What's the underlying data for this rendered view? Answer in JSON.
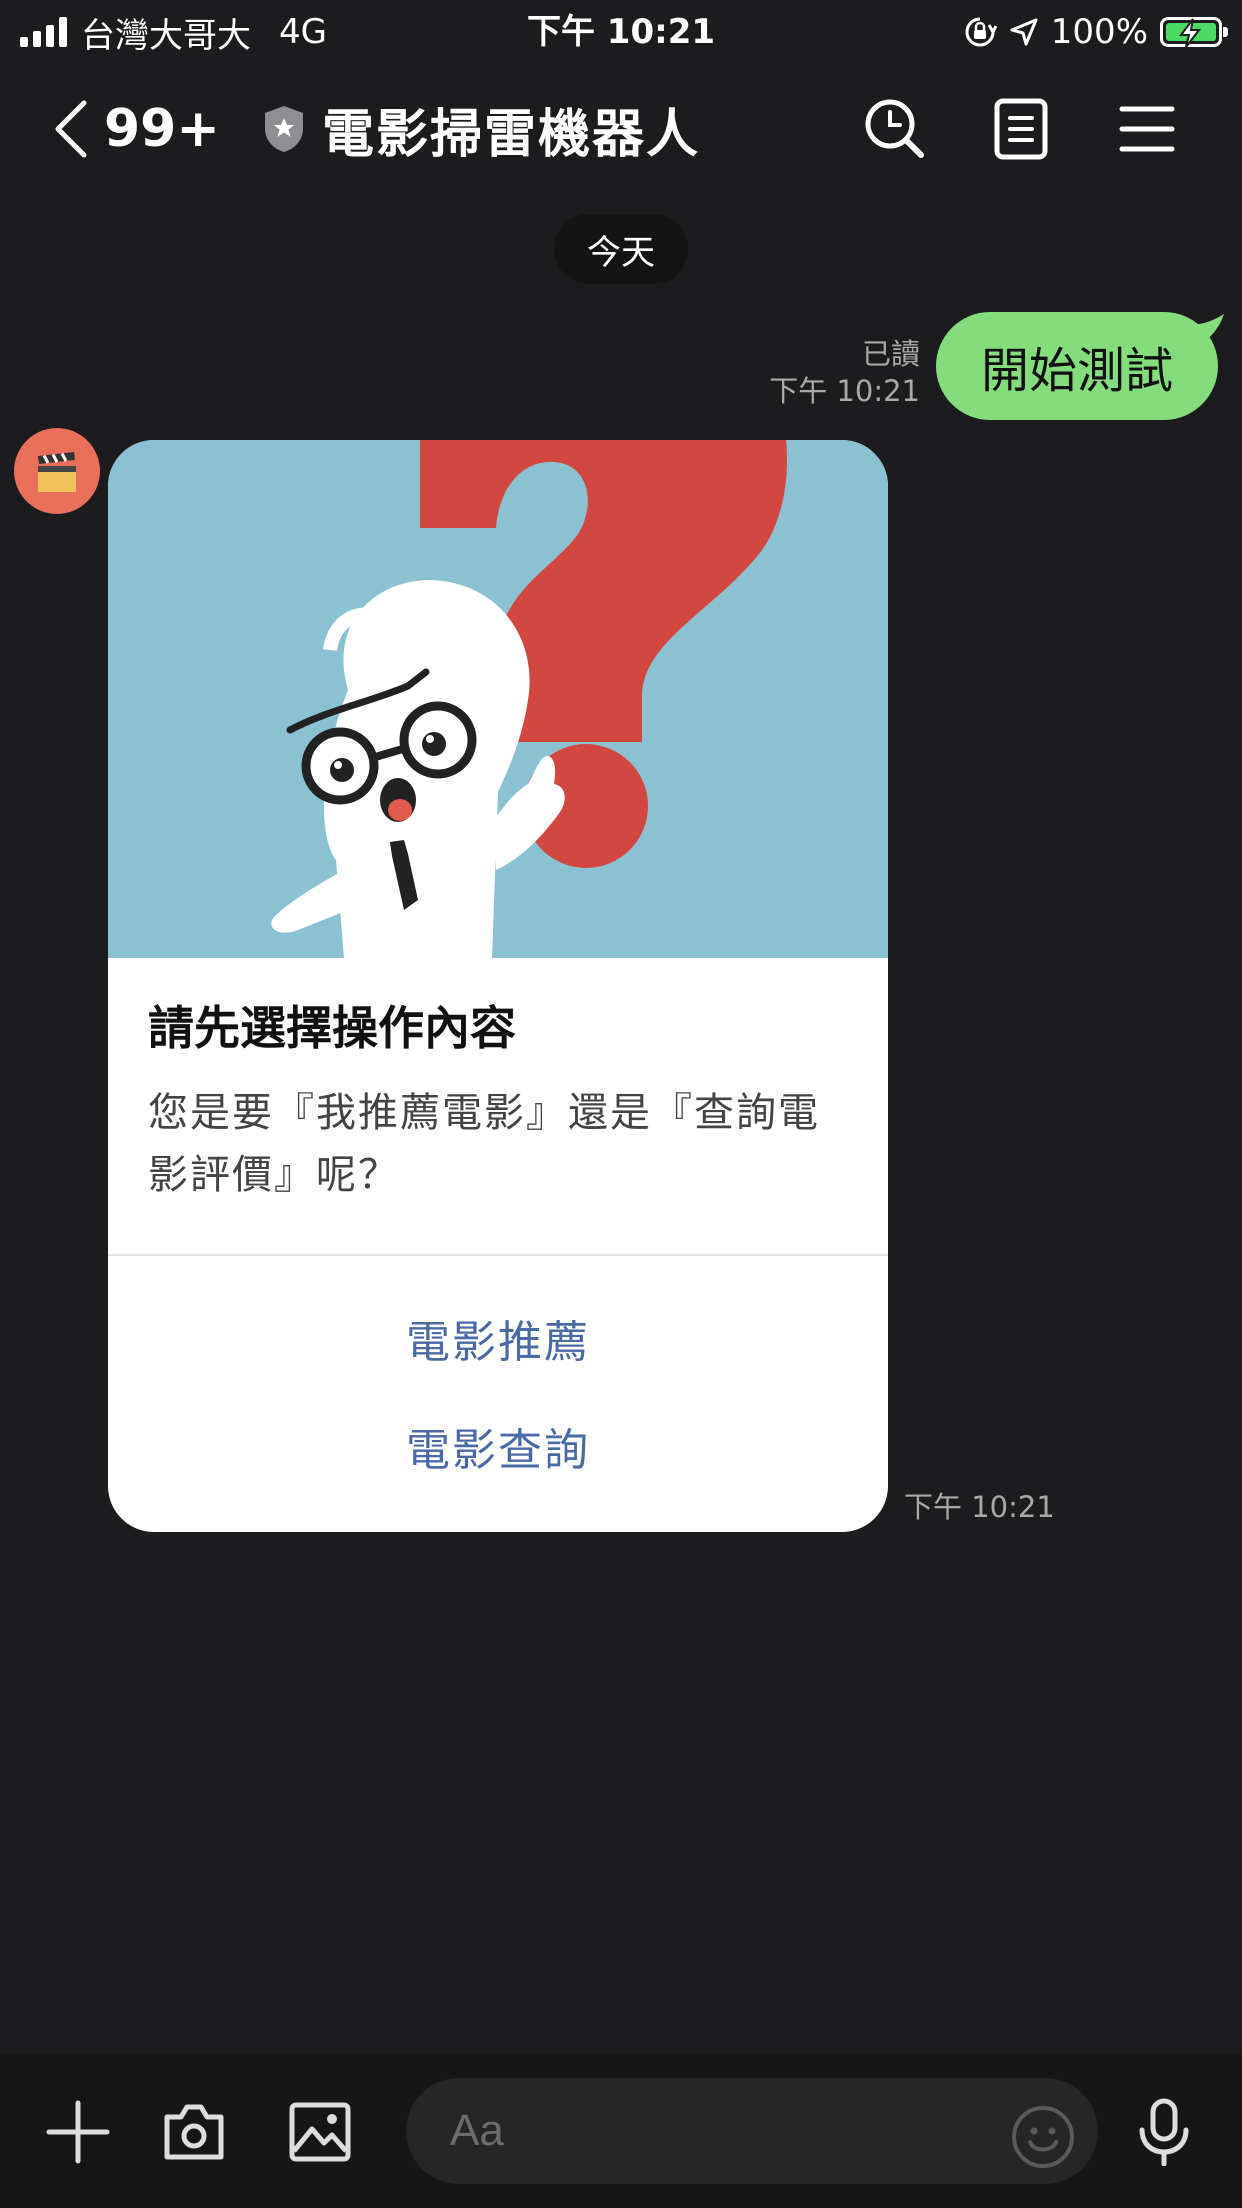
{
  "status_bar": {
    "carrier": "台灣大哥大",
    "network": "4G",
    "time": "下午 10:21",
    "battery_percent": "100%"
  },
  "header": {
    "unread_count": "99+",
    "title": "電影掃雷機器人",
    "icons": [
      "back-icon",
      "shield-icon",
      "search-icon",
      "notes-icon",
      "menu-icon"
    ]
  },
  "date_label": "今天",
  "sent_message": {
    "text": "開始測試",
    "read_label": "已讀",
    "time": "下午 10:21"
  },
  "bot_card": {
    "title": "請先選擇操作內容",
    "text": "您是要『我推薦電影』還是『查詢電影評價』呢？",
    "actions": [
      "電影推薦",
      "電影查詢"
    ],
    "time": "下午 10:21"
  },
  "input": {
    "placeholder": "Aa",
    "icons": [
      "plus-icon",
      "camera-icon",
      "image-icon",
      "emoji-icon",
      "microphone-icon"
    ]
  },
  "colors": {
    "background": "#1c1c1e",
    "sent_bubble": "#85dc7c",
    "card_hero": "#8bc2d2",
    "question_mark": "#d2473f",
    "action_text": "#4a6aa5",
    "battery": "#4cd964"
  }
}
